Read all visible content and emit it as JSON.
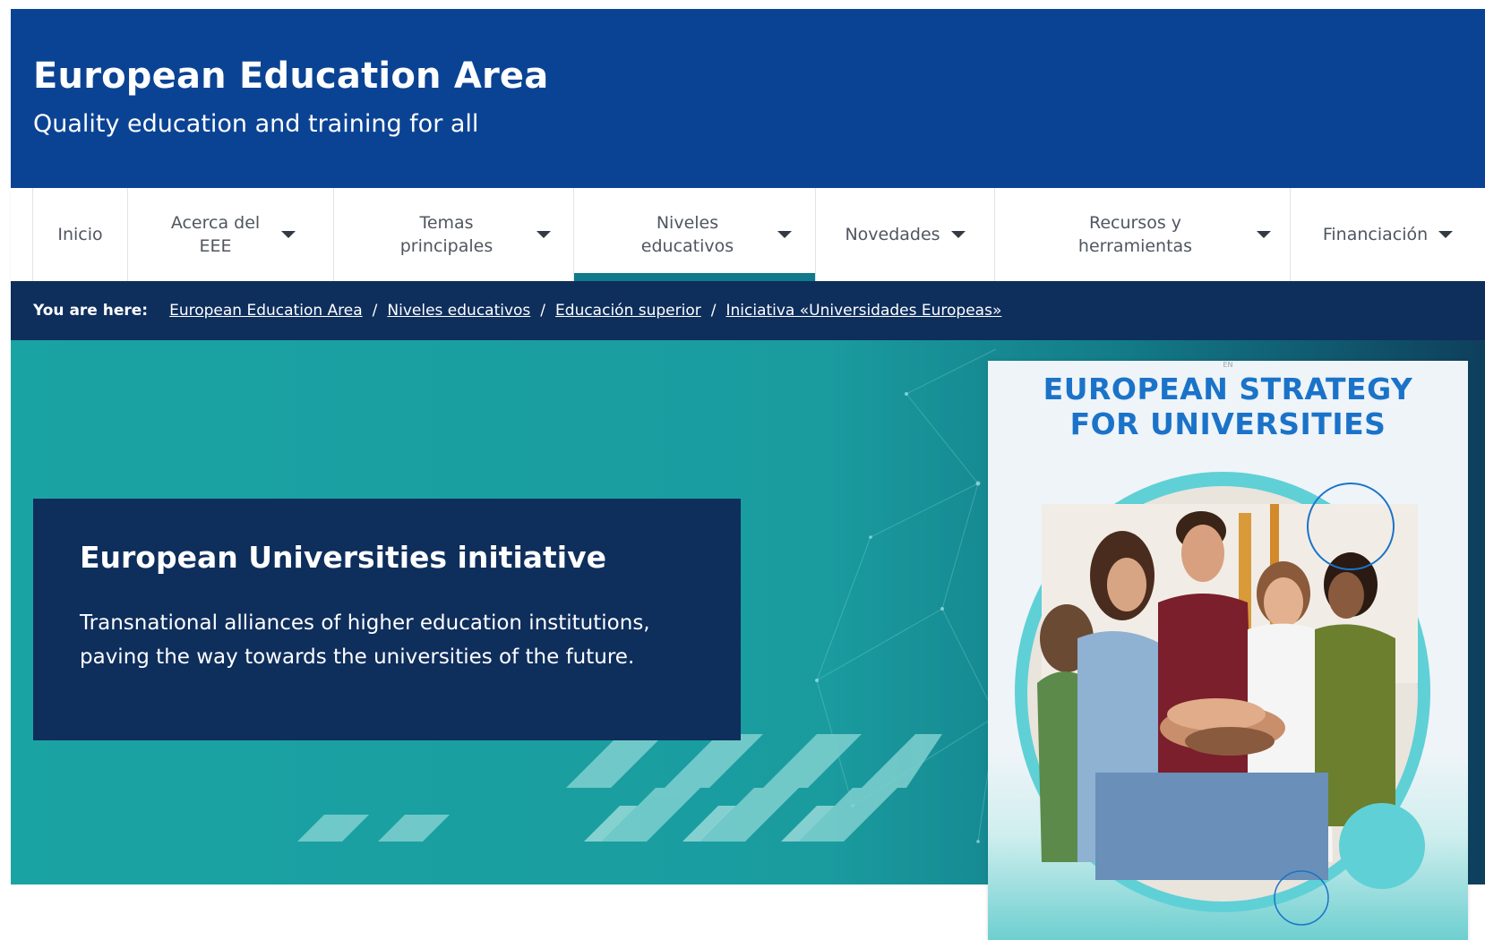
{
  "header": {
    "title": "European Education Area",
    "subtitle": "Quality education and training for all"
  },
  "nav": {
    "items": [
      {
        "label": "Inicio",
        "has_dropdown": false
      },
      {
        "label": "Acerca del EEE",
        "has_dropdown": true
      },
      {
        "label": "Temas principales",
        "has_dropdown": true
      },
      {
        "label": "Niveles educativos",
        "has_dropdown": true,
        "active": true
      },
      {
        "label": "Novedades",
        "has_dropdown": true
      },
      {
        "label": "Recursos y herramientas",
        "has_dropdown": true
      },
      {
        "label": "Financiación",
        "has_dropdown": true
      }
    ]
  },
  "breadcrumb": {
    "prefix": "You are here:",
    "items": [
      "European Education Area",
      "Niveles educativos",
      "Educación superior",
      "Iniciativa «Universidades Europeas»"
    ],
    "separator": "/"
  },
  "hero": {
    "title": "European Universities initiative",
    "text": "Transnational alliances of higher education institutions, paving the way towards the universities of the future."
  },
  "cover": {
    "tag": "EN",
    "title_line1": "EUROPEAN STRATEGY",
    "title_line2": "FOR UNIVERSITIES",
    "image": "group-of-students-stacking-hands-photo"
  },
  "colors": {
    "header_bg": "#0b4394",
    "breadcrumb_bg": "#0e2e5c",
    "hero_card_bg": "#0e2e5c",
    "hero_teal": "#1aa3a3",
    "nav_active_underline": "#0f7a8a",
    "cover_title": "#1b73c9"
  }
}
